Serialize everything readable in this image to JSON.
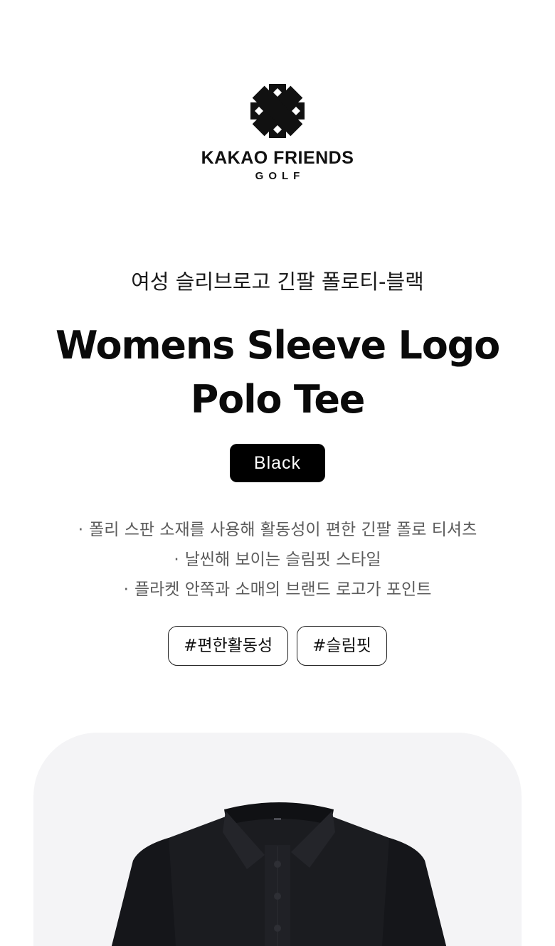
{
  "brand": {
    "logo_icon": "kakao-friends-x-mark-icon",
    "name": "KAKAO FRIENDS",
    "sub": "GOLF"
  },
  "product": {
    "title_kr": "여성 슬리브로고 긴팔 폴로티-블랙",
    "title_en_line1": "Womens Sleeve Logo",
    "title_en_line2": "Polo Tee",
    "color_label": "Black",
    "features": [
      "폴리 스판 소재를 사용해 활동성이 편한 긴팔 폴로 티셔츠",
      "날씬해 보이는 슬림핏 스타일",
      "플라켓 안쪽과 소매의 브랜드 로고가 포인트"
    ],
    "feature_bullet": "·",
    "tags": [
      "#편한활동성",
      "#슬림핏"
    ],
    "image": "black-polo-shirt"
  },
  "colors": {
    "background": "#ffffff",
    "text_primary": "#0a0a0a",
    "text_secondary": "#5c5c5c",
    "badge_bg": "#000000",
    "badge_text": "#ffffff",
    "card_bg": "#f4f4f6",
    "shirt": "#1b1c20"
  }
}
